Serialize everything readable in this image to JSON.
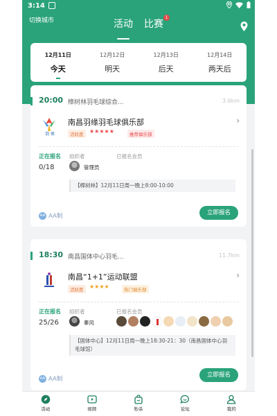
{
  "status_bar": {
    "time": "3:14"
  },
  "header": {
    "city": "切换城市",
    "tabs": [
      {
        "label": "活动",
        "active": true
      },
      {
        "label": "比赛",
        "badge": "1"
      }
    ]
  },
  "dates": [
    {
      "date": "12月11日",
      "weekday": "今天",
      "active": true
    },
    {
      "date": "12月12日",
      "weekday": "明天"
    },
    {
      "date": "12月13日",
      "weekday": "后天"
    },
    {
      "date": "12月14日",
      "weekday": "两天后"
    }
  ],
  "events": [
    {
      "time": "20:00",
      "venue": "樟树林羽毛球综合...",
      "distance": "3.6km",
      "club": "南昌羽缘羽毛球俱乐部",
      "activity_tag": "活跃度",
      "stars": "★★★★★",
      "rating": 5,
      "rec_tag": "推荐俱乐部",
      "status": "正在报名",
      "count": "0/18",
      "organizer_label": "组织者",
      "organizer": "管理员",
      "members_label": "已报名会员",
      "note": "【樟树林】12月11日周一晚上8:00-10:00",
      "aa_icon": "AA",
      "aa": "AA制",
      "signup": "立即报名",
      "logo_text": "羽 体"
    },
    {
      "time": "18:30",
      "venue": "南昌国体中心羽毛...",
      "distance": "11.7km",
      "club": "南昌“1+1”运动联盟",
      "activity_tag": "活跃度",
      "stars": "★★★★",
      "rating": 4,
      "rec_tag": "热门俱乐部",
      "status": "正在报名",
      "count": "25/26",
      "organizer_label": "组织者",
      "organizer": "秦风",
      "members_label": "已报名会员",
      "note": "【国体中心】12月11日周一晚上18:30-21：30（南昌国体中心羽毛球馆）",
      "aa_icon": "AA",
      "aa": "AA制",
      "signup": "立即报名"
    }
  ],
  "tabbar": [
    {
      "label": "活动",
      "icon": "compass-icon"
    },
    {
      "label": "视频",
      "icon": "video-icon"
    },
    {
      "label": "秒杀",
      "icon": "bag-icon"
    },
    {
      "label": "论坛",
      "icon": "chat-icon"
    },
    {
      "label": "我的",
      "icon": "user-icon"
    }
  ],
  "colors": {
    "brand": "#2aa37a",
    "star": "#e74c4c",
    "star2": "#f0a020"
  }
}
